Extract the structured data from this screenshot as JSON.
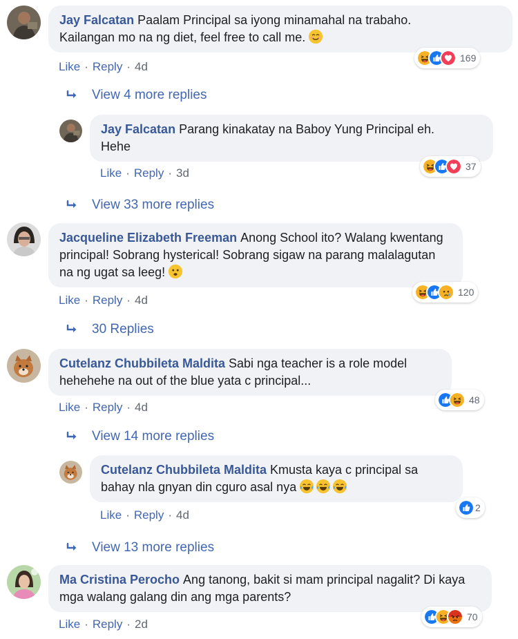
{
  "actions": {
    "like": "Like",
    "reply": "Reply",
    "dot": "·"
  },
  "comments": [
    {
      "name": "Jay Falcatan",
      "text": "Paalam Principal sa iyong minamahal na trabaho.\nKailangan mo na ng diet, feel free to call me.",
      "emoji": "smiling-face-icon",
      "time": "4d",
      "reactions": [
        "haha",
        "like",
        "love"
      ],
      "count": "169"
    },
    {
      "name": "Jay Falcatan",
      "text": "Parang kinakatay na Baboy Yung Principal eh.\nHehe",
      "time": "3d",
      "reactions": [
        "haha",
        "like",
        "love"
      ],
      "count": "37"
    },
    {
      "name": "Jacqueline Elizabeth Freeman",
      "text": "Anong School ito? Walang kwentang principal! Sobrang hysterical! Sobrang sigaw na parang malalagutan na ng ugat sa leeg!",
      "emoji": "sad-face-icon",
      "time": "4d",
      "reactions": [
        "haha",
        "like",
        "sad"
      ],
      "count": "120"
    },
    {
      "name": "Cutelanz Chubbileta Maldita",
      "text": "Sabi nga teacher is a role model hehehehe na out of the blue yata c principal...",
      "time": "4d",
      "reactions": [
        "like",
        "haha"
      ],
      "count": "48"
    },
    {
      "name": "Cutelanz Chubbileta Maldita",
      "text": "Kmusta kaya c principal sa bahay nla gnyan din cguro asal nya",
      "emoji": "tears-of-joy-icon",
      "time": "4d",
      "reactions": [
        "like"
      ],
      "count": "2"
    },
    {
      "name": "Ma Cristina Perocho",
      "text": "Ang tanong, bakit si mam principal nagalit? Di kaya mga walang galang din ang mga parents?",
      "time": "2d",
      "reactions": [
        "like",
        "haha",
        "angry"
      ],
      "count": "70"
    }
  ],
  "view_more": [
    "View 4 more replies",
    "View 33 more replies",
    "30 Replies",
    "View 14 more replies",
    "View 13 more replies"
  ],
  "colors": {
    "name": "#385898",
    "link": "#4267b2",
    "bubble": "#f0f2f5",
    "meta": "#606770"
  }
}
